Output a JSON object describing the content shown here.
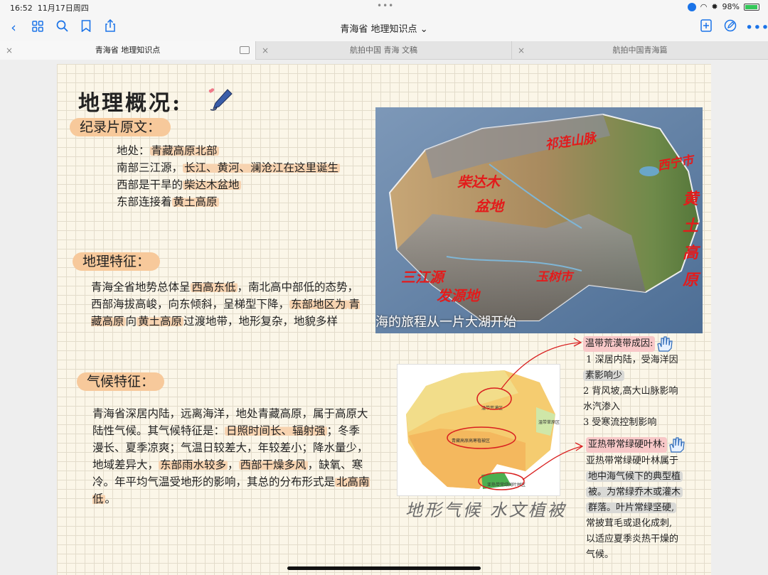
{
  "status": {
    "time": "16:52",
    "date": "11月17日周四",
    "battery": "98%"
  },
  "toolbar": {
    "title": "青海省 地理知识点",
    "title_chevron": "⌄"
  },
  "tabs": [
    {
      "label": "青海省 地理知识点",
      "active": true
    },
    {
      "label": "航拍中国 青海 文稿",
      "active": false
    },
    {
      "label": "航拍中国青海篇",
      "active": false
    }
  ],
  "page": {
    "title": "地理概况:",
    "documentary": {
      "label": "纪录片原文：",
      "lines": [
        [
          "地处：",
          "青藏高原北部"
        ],
        [
          "南部三江源，",
          "长江、黄河、澜沧江在这里诞生"
        ],
        [
          "西部是干旱的",
          "柴达木盆地"
        ],
        [
          "东部连接着",
          "黄土高原"
        ]
      ]
    },
    "features": {
      "label": "地理特征：",
      "text": [
        {
          "t": "青海全省地势总体呈",
          "h": false
        },
        {
          "t": "西高东低",
          "h": true
        },
        {
          "t": "，南北高中部低的态势，西部海拔高峻，向东倾斜，呈梯型下降，",
          "h": false
        },
        {
          "t": "东部地区为",
          "h": true
        },
        {
          "t": "青藏高原",
          "h": true
        },
        {
          "t": "向",
          "h": false
        },
        {
          "t": "黄土高原",
          "h": true
        },
        {
          "t": "过渡地带，地形复杂，地貌多样",
          "h": false
        }
      ]
    },
    "climate": {
      "label": "气候特征：",
      "text": [
        {
          "t": "青海省深居内陆，远离海洋，地处青藏高原，属于高原大陆性气候。其气候特征是：",
          "h": false
        },
        {
          "t": "日照时间长、辐射强",
          "h": true
        },
        {
          "t": "；冬季漫长、夏季凉爽；气温日较差大，年较差小；降水量少，地域差异大，",
          "h": false
        },
        {
          "t": "东部雨水较多",
          "h": true
        },
        {
          "t": "，",
          "h": false
        },
        {
          "t": "西部干燥多风",
          "h": true
        },
        {
          "t": "，缺氧、寒冷。年平均气温受地形的影响，其总的分布形式是",
          "h": false
        },
        {
          "t": "北高南低",
          "h": true
        },
        {
          "t": "。",
          "h": false
        }
      ]
    },
    "map_photo": {
      "caption": "海的旅程从一片大湖开始",
      "notes": {
        "qilian": "祁连山脉",
        "xining": "西宁市",
        "loess": [
          "黄",
          "土",
          "高",
          "原"
        ],
        "qaidam": [
          "柴达木",
          "盆地"
        ],
        "sanjiang": [
          "三江源",
          "发源地"
        ],
        "yushu": "玉树市"
      }
    },
    "climate_map": {
      "zone_desert": "温带荒漠区",
      "zone_steppe": "温带草原区",
      "zone_plateau": "青藏高原高寒植被区",
      "zone_subtropical": "亚热带常绿阔叶林区"
    },
    "desert_note": {
      "title": "温带荒漠带成因:",
      "items": [
        {
          "num": "1",
          "a": "深居内陆，受海洋因",
          "b": "素影响少"
        },
        {
          "num": "2",
          "a": "背风坡,高大山脉影响",
          "b": "水汽渗入"
        },
        {
          "num": "3",
          "a": "受寒流控制影响",
          "b": ""
        }
      ]
    },
    "subtropical_note": {
      "title": "亚热带常绿硬叶林:",
      "lines": [
        {
          "t": "亚热带常绿硬叶林属于",
          "h": false
        },
        {
          "t": "地中海气候下的典型植",
          "h": true
        },
        {
          "t": "被。为常绿乔木或灌木",
          "h": true
        },
        {
          "t": "群落。叶片常绿坚硬,",
          "h": true
        },
        {
          "t": "常披茸毛或退化成刺,",
          "h": false
        },
        {
          "t": "以适应夏季炎热干燥的",
          "h": false
        },
        {
          "t": "气候。",
          "h": false
        }
      ]
    },
    "handwritten_caption": "地形气候 水文植被"
  }
}
